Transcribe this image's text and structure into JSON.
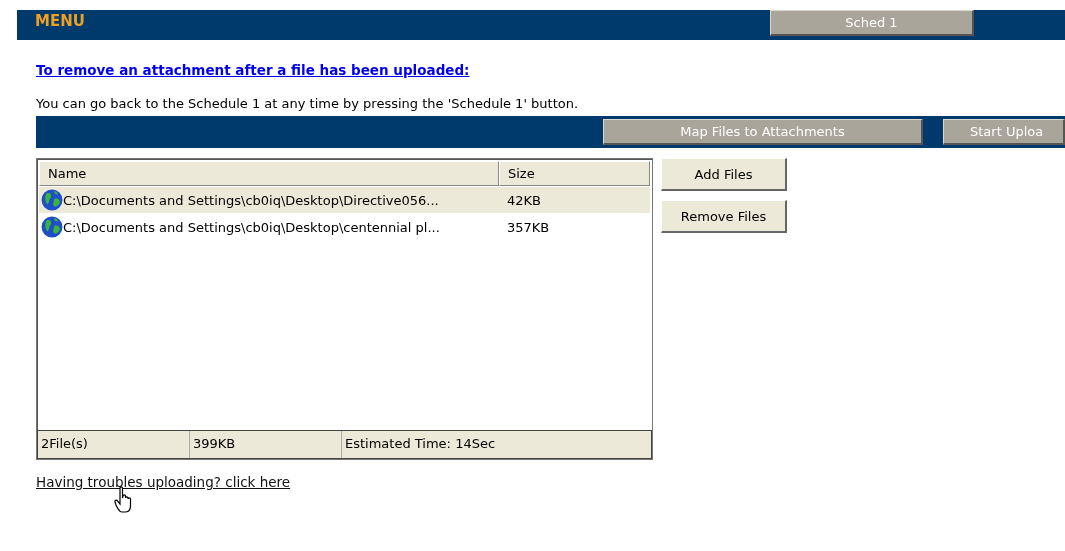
{
  "header": {
    "title": "MENU",
    "button": "Sched 1"
  },
  "heading_link": "To remove an attachment after a file has been uploaded:",
  "instruction": "You can go back to the Schedule 1 at any time by pressing the 'Schedule 1' button.",
  "toolbar": {
    "buttons": [
      "Map Files to Attachments",
      "Start Uploa"
    ]
  },
  "file_list": {
    "columns": [
      "Name",
      "Size"
    ],
    "rows": [
      {
        "name": "C:\\Documents and Settings\\cb0iq\\Desktop\\Directive056...",
        "size": "42KB",
        "selected": true
      },
      {
        "name": "C:\\Documents and Settings\\cb0iq\\Desktop\\centennial pl...",
        "size": "357KB",
        "selected": false
      }
    ],
    "status": [
      "2File(s)",
      "399KB",
      "Estimated Time: 14Sec"
    ]
  },
  "side_buttons": [
    "Add Files",
    "Remove Files"
  ],
  "help_link": "Having troubles uploading? click here"
}
